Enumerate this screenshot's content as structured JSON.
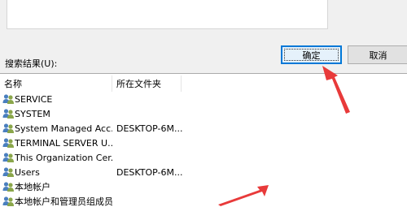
{
  "dialog": {
    "search_results_label": "搜索结果(U):",
    "ok_label": "确定",
    "cancel_label": "取消"
  },
  "columns": {
    "name": "名称",
    "folder": "所在文件夹"
  },
  "rows": [
    {
      "name": "SERVICE",
      "folder": ""
    },
    {
      "name": "SYSTEM",
      "folder": ""
    },
    {
      "name": "System Managed Acc...",
      "folder": "DESKTOP-6M..."
    },
    {
      "name": "TERMINAL SERVER U...",
      "folder": ""
    },
    {
      "name": "This Organization Cer...",
      "folder": ""
    },
    {
      "name": "Users",
      "folder": "DESKTOP-6M..."
    },
    {
      "name": "本地帐户",
      "folder": ""
    },
    {
      "name": "本地帐户和管理员组成员",
      "folder": ""
    }
  ],
  "colors": {
    "annotation_arrow": "#e83a3a",
    "ok_button_border": "#0078d7"
  },
  "icons": {
    "row_icon": "user-group-icon"
  }
}
